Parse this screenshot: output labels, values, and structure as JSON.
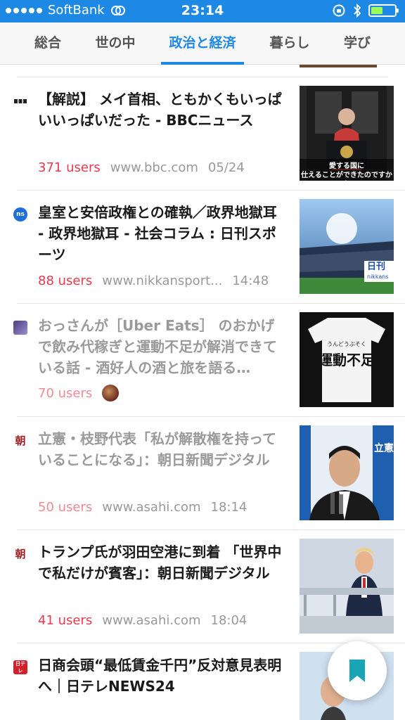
{
  "status_bar": {
    "carrier": "SoftBank",
    "time": "23:14",
    "battery_level": 0.5,
    "colors": {
      "background": "#1e88e5",
      "battery_fill": "#9cff5a"
    }
  },
  "tabs": [
    {
      "label": "総合",
      "active": false
    },
    {
      "label": "世の中",
      "active": false
    },
    {
      "label": "政治と経済",
      "active": true
    },
    {
      "label": "暮らし",
      "active": false
    },
    {
      "label": "学び",
      "active": false
    }
  ],
  "entries": [
    {
      "favicon": "bbc-icon",
      "title": "【解説】 メイ首相、ともかくもいっぱいいっぱいだった - BBCニュース",
      "users": "371 users",
      "domain": "www.bbc.com",
      "date": "05/24",
      "read": false,
      "thumb_caption_1": "愛する国に",
      "thumb_caption_2": "仕えることができたのですから"
    },
    {
      "favicon": "nikkansports-icon",
      "favicon_text": "ns",
      "title": "皇室と安倍政権との確執／政界地獄耳 - 政界地獄耳 - 社会コラム : 日刊スポーツ",
      "users": "88 users",
      "domain": "www.nikkansport...",
      "date": "14:48",
      "read": false,
      "thumb_label": "日刊",
      "thumb_sub": "nikkans"
    },
    {
      "favicon": "blog-icon",
      "title": "おっさんが［Uber Eats］ のおかげで飲み代稼ぎと運動不足が解消できている話 - 酒好人の酒と旅を語る…",
      "users": "70 users",
      "read": true,
      "thumb_small": "うんどうぶそく",
      "thumb_big": "運動不足"
    },
    {
      "favicon": "asahi-icon",
      "favicon_text": "朝",
      "title": "立憲・枝野代表「私が解散権を持っていることになる」：朝日新聞デジタル",
      "users": "50 users",
      "domain": "www.asahi.com",
      "date": "18:14",
      "read": true,
      "thumb_banner": "立憲"
    },
    {
      "favicon": "asahi-icon",
      "favicon_text": "朝",
      "title": "トランプ氏が羽田空港に到着 「世界中で私だけが賓客」：朝日新聞デジタル",
      "users": "41 users",
      "domain": "www.asahi.com",
      "date": "18:04",
      "read": false
    },
    {
      "favicon": "ntv-news24-icon",
      "favicon_text": "日テレ",
      "title": "日商会頭“最低賃金千円”反対意見表明へ｜日テレNEWS24",
      "read": false
    }
  ],
  "fab": {
    "icon": "bookmark-icon",
    "color": "#1ba3b6"
  }
}
